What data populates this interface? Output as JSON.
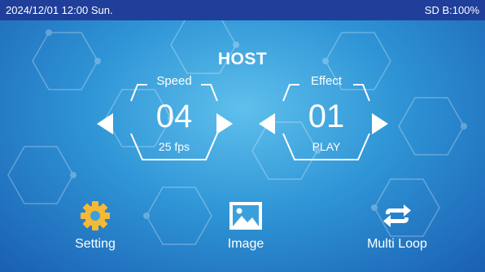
{
  "status_bar": {
    "datetime": "2024/12/01 12:00 Sun.",
    "storage": "SD B:100%"
  },
  "title": "HOST",
  "speed": {
    "label": "Speed",
    "value": "04",
    "sub": "25 fps"
  },
  "effect": {
    "label": "Effect",
    "value": "01",
    "sub": "PLAY"
  },
  "functions": [
    {
      "label": "Setting",
      "icon": "gear-icon"
    },
    {
      "label": "Image",
      "icon": "image-icon"
    },
    {
      "label": "Multi Loop",
      "icon": "loop-icon"
    }
  ],
  "colors": {
    "status_bar_bg": "#1f3f9a",
    "background": "#2f95d6",
    "gear_icon": "#f5b935",
    "text": "#ffffff"
  }
}
